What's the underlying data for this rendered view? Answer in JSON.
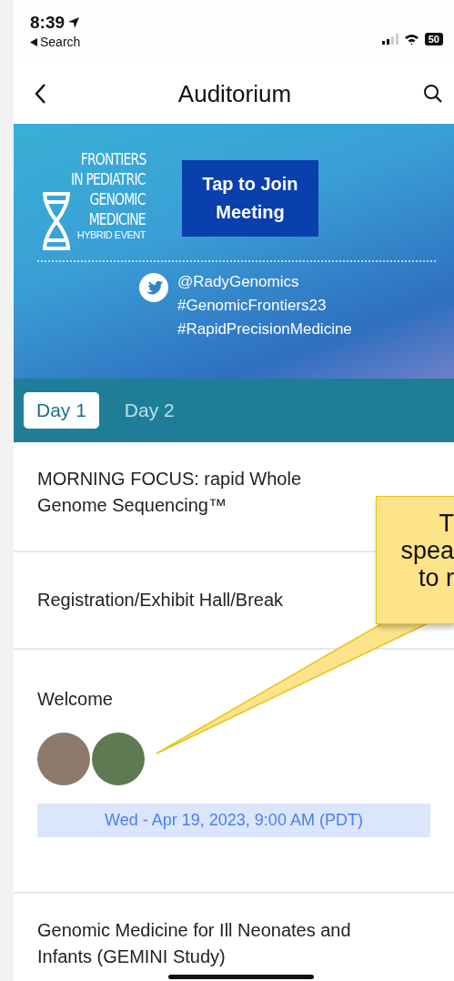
{
  "status_bar": {
    "time": "8:39",
    "back_label": "Search",
    "battery": "50"
  },
  "nav": {
    "title": "Auditorium"
  },
  "banner": {
    "logo_lines": [
      "FRONTIERS",
      "IN PEDIATRIC",
      "GENOMIC",
      "MEDICINE"
    ],
    "logo_subtitle": "HYBRID EVENT",
    "join_button": "Tap to Join Meeting",
    "handle": "@RadyGenomics",
    "hashtags": [
      "#GenomicFrontiers23",
      "#RapidPrecisionMedicine"
    ]
  },
  "tabs": [
    {
      "label": "Day 1",
      "selected": true
    },
    {
      "label": "Day 2",
      "selected": false
    }
  ],
  "sessions": [
    {
      "title": "MORNING FOCUS: rapid Whole Genome Sequencing™"
    },
    {
      "title": "Registration/Exhibit Hall/Break"
    },
    {
      "title": "Welcome",
      "speakers": [
        {
          "kind": "photo"
        },
        {
          "kind": "photo"
        }
      ],
      "date": "Wed - Apr 19, 2023, 9:00 AM (PDT)"
    },
    {
      "title": "Genomic Medicine for Ill Neonates and Infants (GEMINI Study)"
    }
  ],
  "callout": {
    "lines": [
      "T",
      "spea",
      "to r"
    ]
  }
}
